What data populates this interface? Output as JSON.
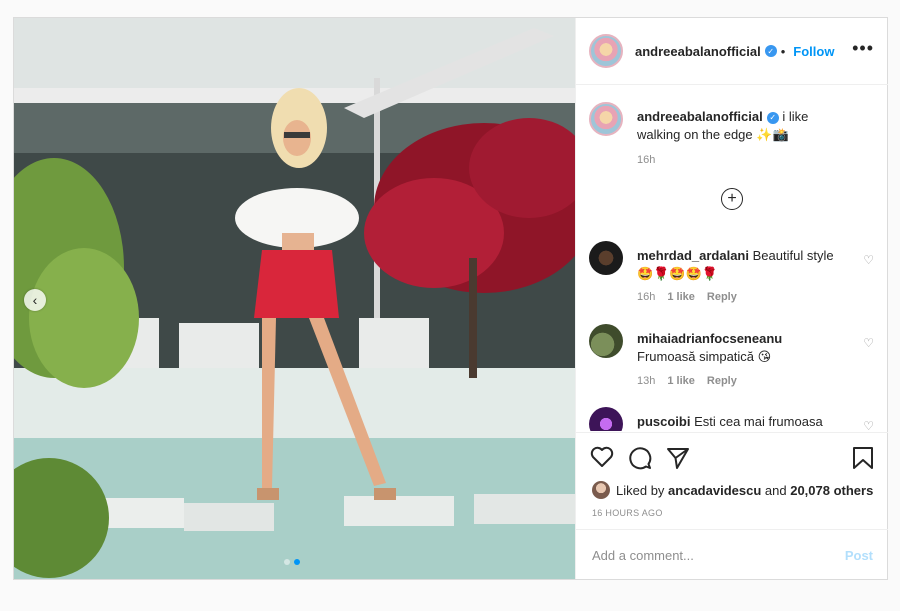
{
  "colors": {
    "accent": "#0095f6",
    "skirt": "#d9263b",
    "foliage_red": "#a4182e"
  },
  "media": {
    "slides": 2,
    "active_slide": 2,
    "prev_arrow": "‹"
  },
  "header": {
    "username": "andreeabalanofficial",
    "verified_icon": "✓",
    "follow": "Follow",
    "more": "•••"
  },
  "caption": {
    "username": "andreeabalanofficial",
    "verified_icon": "✓",
    "text": "i like walking on the edge ✨📸",
    "time": "16h"
  },
  "load_more": "+",
  "comments": [
    {
      "username": "mehrdad_ardalani",
      "text": "Beautiful style",
      "emoji": "🤩🌹🤩🤩🌹",
      "time": "16h",
      "likes": "1 like",
      "reply": "Reply"
    },
    {
      "username": "mihaiadrianfocseneanu",
      "text": "Frumoasă simpatică 😘",
      "time": "13h",
      "likes": "1 like",
      "reply": "Reply"
    },
    {
      "username": "puscoibi",
      "text": "Esti cea mai frumoasa"
    }
  ],
  "heart_icon": "♡",
  "likes": {
    "prefix": "Liked by ",
    "user": "ancadavidescu",
    "middle": " and ",
    "others": "20,078 others"
  },
  "posted": "16 HOURS AGO",
  "add_comment": {
    "placeholder": "Add a comment...",
    "post": "Post"
  }
}
